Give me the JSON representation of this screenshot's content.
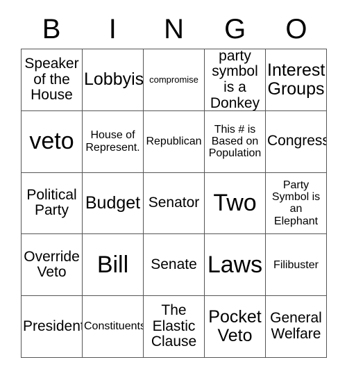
{
  "card": {
    "header_letters": [
      "B",
      "I",
      "N",
      "G",
      "O"
    ],
    "rows": [
      [
        {
          "text": "Speaker of the House",
          "size": "md"
        },
        {
          "text": "Lobbyist",
          "size": "lg"
        },
        {
          "text": "compromise",
          "size": "xs"
        },
        {
          "text": "party symbol is a Donkey",
          "size": "md"
        },
        {
          "text": "Interest Groups",
          "size": "lg"
        }
      ],
      [
        {
          "text": "veto",
          "size": "xl"
        },
        {
          "text": "House of Represent.",
          "size": "sm"
        },
        {
          "text": "Republican",
          "size": "sm"
        },
        {
          "text": "This # is Based on Population",
          "size": "sm"
        },
        {
          "text": "Congress",
          "size": "md"
        }
      ],
      [
        {
          "text": "Political Party",
          "size": "md"
        },
        {
          "text": "Budget",
          "size": "lg"
        },
        {
          "text": "Senator",
          "size": "md"
        },
        {
          "text": "Two",
          "size": "xl"
        },
        {
          "text": "Party Symbol is an Elephant",
          "size": "sm"
        }
      ],
      [
        {
          "text": "Override Veto",
          "size": "md"
        },
        {
          "text": "Bill",
          "size": "xl"
        },
        {
          "text": "Senate",
          "size": "md"
        },
        {
          "text": "Laws",
          "size": "xl"
        },
        {
          "text": "Filibuster",
          "size": "sm"
        }
      ],
      [
        {
          "text": "President",
          "size": "md"
        },
        {
          "text": "Constituents",
          "size": "sm"
        },
        {
          "text": "The Elastic Clause",
          "size": "md"
        },
        {
          "text": "Pocket Veto",
          "size": "lg"
        },
        {
          "text": "General Welfare",
          "size": "md"
        }
      ]
    ],
    "colors": {
      "background": "#ffffff",
      "text": "#000000",
      "border": "#555555"
    }
  }
}
